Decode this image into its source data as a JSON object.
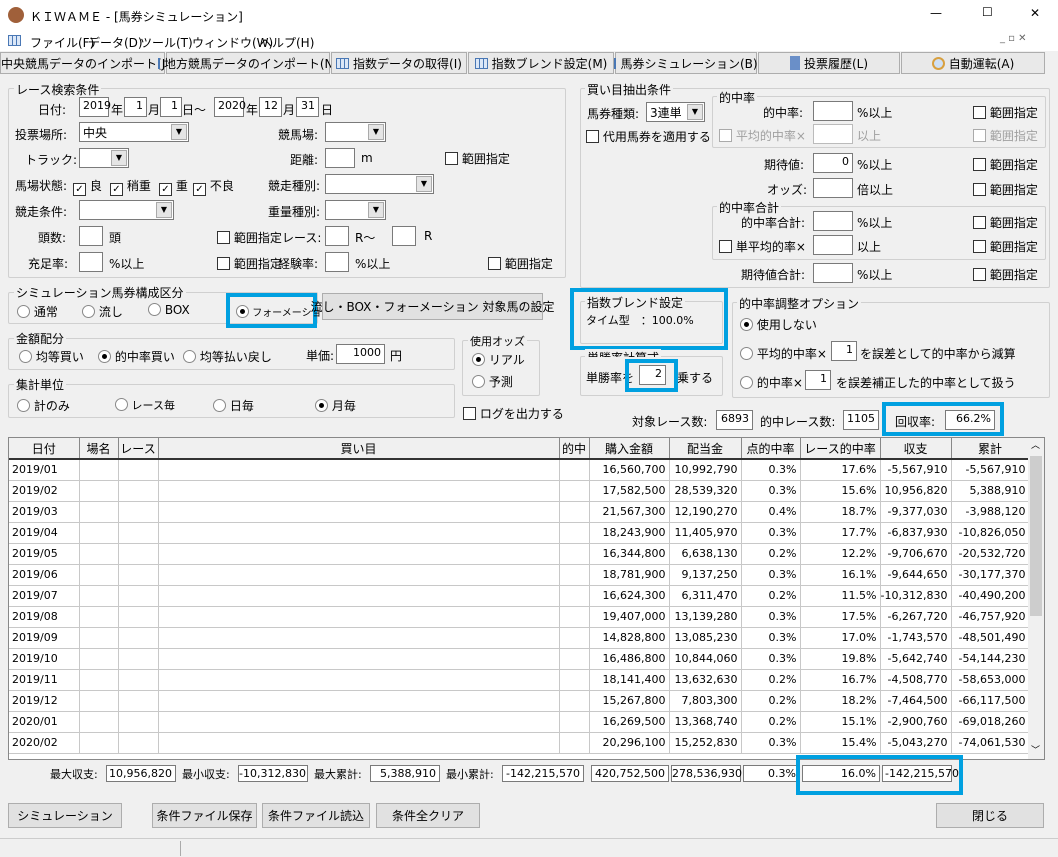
{
  "window": {
    "app_title": "ＫＩＷＡＭＥ - [馬券シミュレーション]",
    "min": "—",
    "max": "☐",
    "close": "✕"
  },
  "menu": [
    "ファイル(F)",
    "データ(D)",
    "ツール(T)",
    "ウィンドウ(W)",
    "ヘルプ(H)"
  ],
  "toolbar": [
    "中央競馬データのインポート(J)",
    "地方競馬データのインポート(N)",
    "指数データの取得(I)",
    "指数ブレンド設定(M)",
    "馬券シミュレーション(B)",
    "投票履歴(L)",
    "自動運転(A)"
  ],
  "race": {
    "title": "レース検索条件",
    "date_label": "日付:",
    "from_year": "2019",
    "from_month": "1",
    "from_day": "1",
    "to_year": "2020",
    "to_month": "12",
    "to_day": "31",
    "year": "年",
    "month": "月",
    "day": "日",
    "tilde_day": "日～",
    "venue_label": "投票場所:",
    "venue": "中央",
    "course_label": "競馬場:",
    "track_label": "トラック:",
    "distance_label": "距離:",
    "m": "m",
    "range": "範囲指定",
    "condition_label": "馬場状態:",
    "conditions": [
      "良",
      "稍重",
      "重",
      "不良"
    ],
    "race_type_label": "競走種別:",
    "race_cond_label": "競走条件:",
    "weight_label": "重量種別:",
    "heads_label": "頭数:",
    "heads_unit": "頭",
    "race_label": "レース:",
    "r_from": "R～",
    "r_to": "R",
    "fill_label": "充足率:",
    "pct_over": "%以上",
    "exp_label": "経験率:"
  },
  "sim_type": {
    "title": "シミュレーション馬券構成区分",
    "options": [
      "通常",
      "流し",
      "BOX",
      "フォーメーション"
    ],
    "selected": 3,
    "target_button": "流し・BOX・フォーメーション 対象馬の設定"
  },
  "money": {
    "title": "金額配分",
    "options": [
      "均等買い",
      "的中率買い",
      "均等払い戻し"
    ],
    "selected": 1,
    "unit_label": "単価:",
    "unit": "1000",
    "yen": "円"
  },
  "agg": {
    "title": "集計単位",
    "options": [
      "計のみ",
      "レース毎",
      "日毎",
      "月毎"
    ],
    "selected": 3
  },
  "odds": {
    "title": "使用オッズ",
    "options": [
      "リアル",
      "予測"
    ],
    "selected": 0
  },
  "log_label": "ログを出力する",
  "pick": {
    "title": "買い目抽出条件",
    "bet_type_label": "馬券種類:",
    "bet_type": "3連単",
    "substitute": "代用馬券を適用する",
    "hit": {
      "title": "的中率",
      "rate_label": "的中率:",
      "pct_over": "%以上",
      "avg_label": "平均的中率×",
      "over": "以上",
      "range": "範囲指定"
    },
    "ev_label": "期待値:",
    "ev": "0",
    "odds_label": "オッズ:",
    "odds_over": "倍以上",
    "hitsum": {
      "title": "的中率合計",
      "sum_label": "的中率合計:",
      "single_label": "単平均的率×"
    },
    "evsum_label": "期待値合計:"
  },
  "blend": {
    "title": "指数ブレンド設定",
    "line": "タイム型　：100.0%"
  },
  "win": {
    "title": "単勝率計算式",
    "pre": "単勝率を",
    "value": "2",
    "post": "乗する"
  },
  "adjust": {
    "title": "的中率調整オプション",
    "opt0": "使用しない",
    "opt1_pre": "平均的中率×",
    "opt1_val": "1",
    "opt1_post": "を誤差として的中率から減算",
    "opt2_pre": "的中率×",
    "opt2_val": "1",
    "opt2_post": "を誤差補正した的中率として扱う",
    "selected": 0
  },
  "stats": {
    "target_label": "対象レース数:",
    "target": "6893",
    "hit_label": "的中レース数:",
    "hit": "1105",
    "recovery_label": "回収率:",
    "recovery": "66.2%"
  },
  "table": {
    "headers": [
      "日付",
      "場名",
      "レース",
      "買い目",
      "的中",
      "購入金額",
      "配当金",
      "点的中率",
      "レース的中率",
      "収支",
      "累計"
    ],
    "rows": [
      [
        "2019/01",
        "",
        "",
        "",
        "",
        "16,560,700",
        "10,992,790",
        "0.3%",
        "17.6%",
        "-5,567,910",
        "-5,567,910"
      ],
      [
        "2019/02",
        "",
        "",
        "",
        "",
        "17,582,500",
        "28,539,320",
        "0.3%",
        "15.6%",
        "10,956,820",
        "5,388,910"
      ],
      [
        "2019/03",
        "",
        "",
        "",
        "",
        "21,567,300",
        "12,190,270",
        "0.4%",
        "18.7%",
        "-9,377,030",
        "-3,988,120"
      ],
      [
        "2019/04",
        "",
        "",
        "",
        "",
        "18,243,900",
        "11,405,970",
        "0.3%",
        "17.7%",
        "-6,837,930",
        "-10,826,050"
      ],
      [
        "2019/05",
        "",
        "",
        "",
        "",
        "16,344,800",
        "6,638,130",
        "0.2%",
        "12.2%",
        "-9,706,670",
        "-20,532,720"
      ],
      [
        "2019/06",
        "",
        "",
        "",
        "",
        "18,781,900",
        "9,137,250",
        "0.3%",
        "16.1%",
        "-9,644,650",
        "-30,177,370"
      ],
      [
        "2019/07",
        "",
        "",
        "",
        "",
        "16,624,300",
        "6,311,470",
        "0.2%",
        "11.5%",
        "-10,312,830",
        "-40,490,200"
      ],
      [
        "2019/08",
        "",
        "",
        "",
        "",
        "19,407,000",
        "13,139,280",
        "0.3%",
        "17.5%",
        "-6,267,720",
        "-46,757,920"
      ],
      [
        "2019/09",
        "",
        "",
        "",
        "",
        "14,828,800",
        "13,085,230",
        "0.3%",
        "17.0%",
        "-1,743,570",
        "-48,501,490"
      ],
      [
        "2019/10",
        "",
        "",
        "",
        "",
        "16,486,800",
        "10,844,060",
        "0.3%",
        "19.8%",
        "-5,642,740",
        "-54,144,230"
      ],
      [
        "2019/11",
        "",
        "",
        "",
        "",
        "18,141,400",
        "13,632,630",
        "0.2%",
        "16.7%",
        "-4,508,770",
        "-58,653,000"
      ],
      [
        "2019/12",
        "",
        "",
        "",
        "",
        "15,267,800",
        "7,803,300",
        "0.2%",
        "18.2%",
        "-7,464,500",
        "-66,117,500"
      ],
      [
        "2020/01",
        "",
        "",
        "",
        "",
        "16,269,500",
        "13,368,740",
        "0.2%",
        "15.1%",
        "-2,900,760",
        "-69,018,260"
      ],
      [
        "2020/02",
        "",
        "",
        "",
        "",
        "20,296,100",
        "15,252,830",
        "0.3%",
        "15.4%",
        "-5,043,270",
        "-74,061,530"
      ]
    ]
  },
  "summary": {
    "max_label": "最大収支:",
    "max": "10,956,820",
    "min_label": "最小収支:",
    "min": "-10,312,830",
    "maxcum_label": "最大累計:",
    "maxcum": "5,388,910",
    "mincum_label": "最小累計:",
    "mincum": "-142,215,570",
    "buy": "420,752,500",
    "pay": "278,536,930",
    "point_rate": "0.3%",
    "race_rate": "16.0%",
    "total": "-142,215,570"
  },
  "buttons": {
    "simulate": "シミュレーション",
    "save": "条件ファイル保存",
    "load": "条件ファイル読込",
    "clear": "条件全クリア",
    "close": "閉じる"
  },
  "colors": {
    "highlight": "#00a0e0"
  }
}
